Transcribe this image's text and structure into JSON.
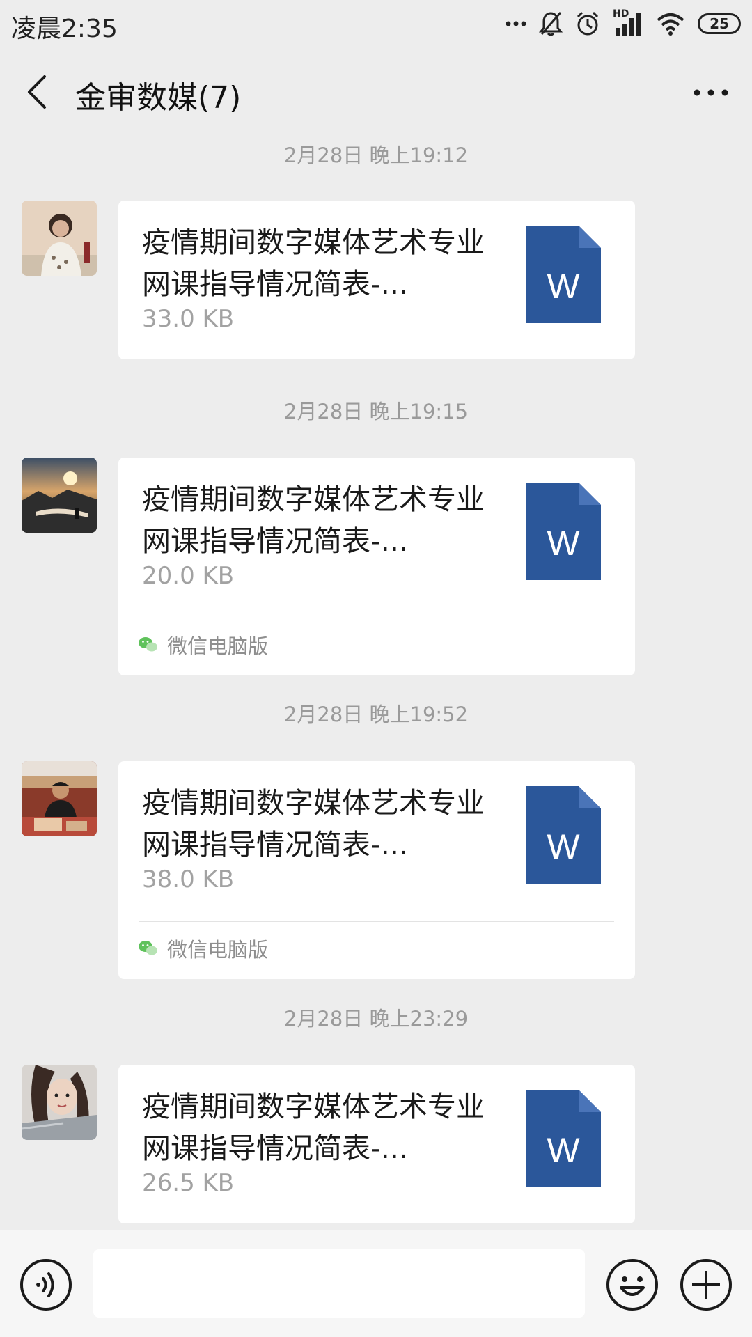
{
  "status_bar": {
    "time": "凌晨2:35",
    "battery": "25",
    "network_label": "HD"
  },
  "header": {
    "title": "金审数媒(7)"
  },
  "messages": [
    {
      "timestamp": "2月28日 晚上19:12",
      "file_name": "疫情期间数字媒体艺术专业网课指导情况简表-...",
      "file_size": "33.0 KB",
      "file_icon_letter": "W"
    },
    {
      "timestamp": "2月28日 晚上19:15",
      "file_name": "疫情期间数字媒体艺术专业网课指导情况简表-...",
      "file_size": "20.0 KB",
      "file_icon_letter": "W",
      "source": "微信电脑版"
    },
    {
      "timestamp": "2月28日 晚上19:52",
      "file_name": "疫情期间数字媒体艺术专业网课指导情况简表-...",
      "file_size": "38.0 KB",
      "file_icon_letter": "W",
      "source": "微信电脑版"
    },
    {
      "timestamp": "2月28日 晚上23:29",
      "file_name": "疫情期间数字媒体艺术专业网课指导情况简表-...",
      "file_size": "26.5 KB",
      "file_icon_letter": "W"
    }
  ],
  "icons": {
    "back": "chevron-left-icon",
    "more": "more-dots-icon",
    "file": "word-document-icon",
    "source": "wechat-icon",
    "voice": "voice-icon",
    "emoji": "emoji-icon",
    "plus": "plus-icon"
  },
  "colors": {
    "word_blue": "#2b579a",
    "word_fold": "#4a74b8",
    "background": "#ededed",
    "bubble": "#ffffff",
    "wechat_green": "#5fc25b"
  }
}
